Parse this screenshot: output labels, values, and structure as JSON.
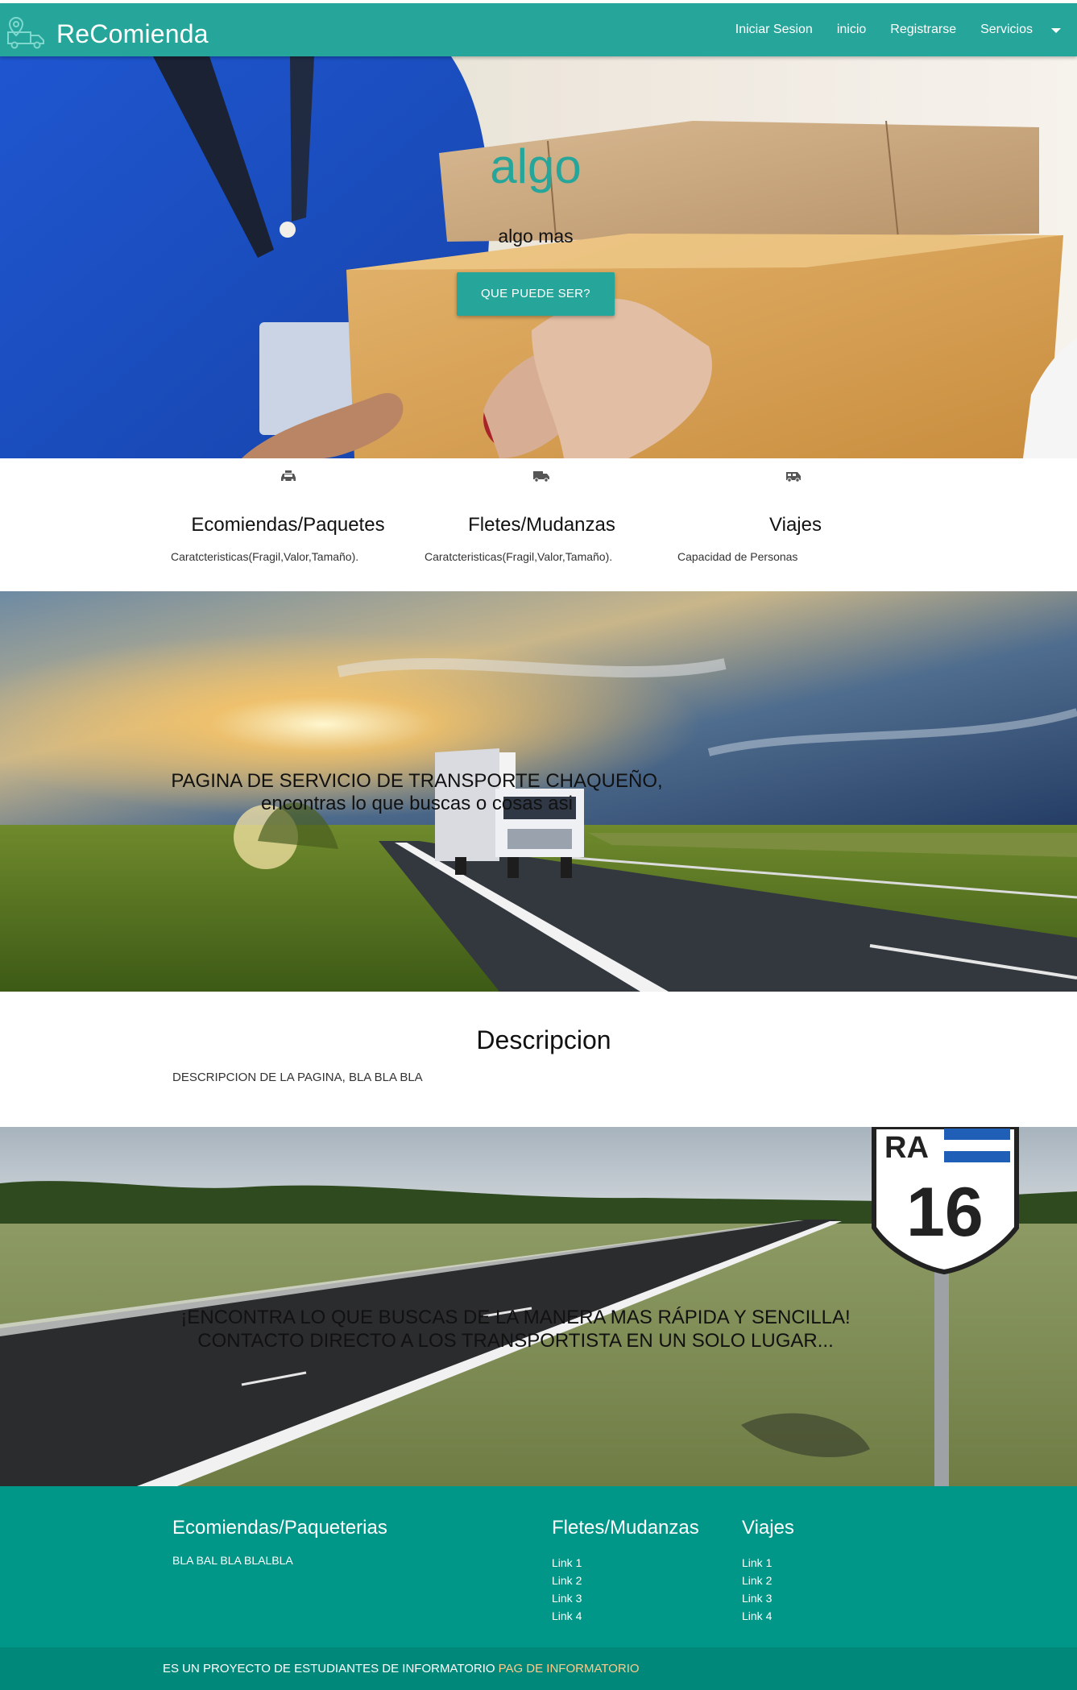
{
  "header": {
    "brand": "ReComienda",
    "logo_icon": "truck-location-icon",
    "nav": [
      "Iniciar Sesion",
      "inicio",
      "Registrarse",
      "Servicios"
    ],
    "dropdown_icon": "caret-down-icon"
  },
  "hero": {
    "title": "algo",
    "subtitle": "algo mas",
    "button": "QUE PUEDE SER?"
  },
  "features": [
    {
      "icon": "taxi-icon",
      "title": "Ecomiendas/Paquetes",
      "desc": "Caratcteristicas(Fragil,Valor,Tamaño)."
    },
    {
      "icon": "truck-icon",
      "title": "Fletes/Mudanzas",
      "desc": "Caratcteristicas(Fragil,Valor,Tamaño)."
    },
    {
      "icon": "van-icon",
      "title": "Viajes",
      "desc": "Capacidad de Personas"
    }
  ],
  "parallax1": {
    "line1": "PAGINA DE SERVICIO DE TRANSPORTE CHAQUEÑO,",
    "line2": "encontras lo que buscas o cosas asi"
  },
  "description": {
    "title": "Descripcion",
    "text": "DESCRIPCION DE LA PAGINA, BLA BLA BLA"
  },
  "parallax2": {
    "line1": "¡ENCONTRA LO QUE BUSCAS DE LA MANERA MAS RÁPIDA Y SENCILLA!",
    "line2": "CONTACTO DIRECTO A LOS TRANSPORTISTA EN UN SOLO LUGAR...",
    "sign_text": "RA",
    "sign_number": "16"
  },
  "footer": {
    "col1_title": "Ecomiendas/Paqueterias",
    "col1_text": "BLA BAL BLA BLALBLA",
    "col2_title": "Fletes/Mudanzas",
    "col2_links": [
      "Link 1",
      "Link 2",
      "Link 3",
      "Link 4"
    ],
    "col3_title": "Viajes",
    "col3_links": [
      "Link 1",
      "Link 2",
      "Link 3",
      "Link 4"
    ],
    "copyright": "ES UN PROYECTO DE ESTUDIANTES DE INFORMATORIO",
    "copyright_link": "PAG DE INFORMATORIO"
  },
  "colors": {
    "primary": "#26a69a",
    "footer": "#009688",
    "footer_bottom": "#00897b",
    "link_accent": "#ffca8a"
  }
}
